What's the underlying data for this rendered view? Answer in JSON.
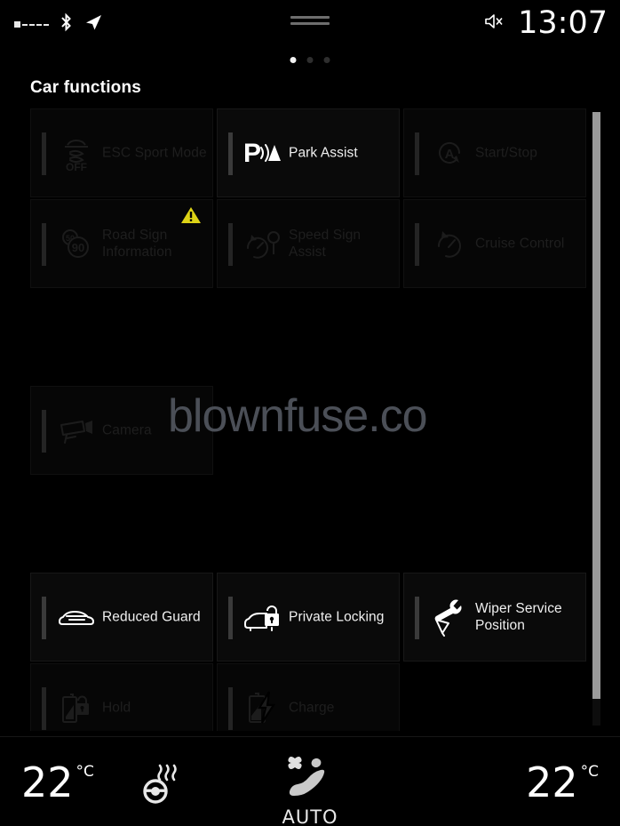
{
  "status_bar": {
    "signal_icon": "signal-strength-icon",
    "bluetooth_icon": "bluetooth-icon",
    "navigation_icon": "navigation-arrow-icon",
    "mute_icon": "volume-mute-icon",
    "clock": "13:07",
    "grab_handle_icon": "drag-handle-icon"
  },
  "page_dots": {
    "total": 3,
    "active_index": 0
  },
  "header": {
    "title": "Car functions"
  },
  "watermark": {
    "text": "blownfuse.co"
  },
  "scrollbar": {
    "name": "vertical-scrollbar"
  },
  "tiles": [
    {
      "id": "esc-sport-mode",
      "label": "ESC Sport Mode",
      "icon": "esc-off-icon",
      "state": "dim",
      "badge": null,
      "sublabel": "OFF"
    },
    {
      "id": "park-assist",
      "label": "Park Assist",
      "icon": "park-assist-icon",
      "state": "active",
      "badge": null
    },
    {
      "id": "start-stop",
      "label": "Start/Stop",
      "icon": "auto-start-stop-icon",
      "state": "dim",
      "badge": null
    },
    {
      "id": "road-sign-information",
      "label": "Road Sign Information",
      "icon": "road-sign-icon",
      "state": "dim",
      "badge": "warning-triangle-icon",
      "sign_values": [
        "50",
        "90"
      ]
    },
    {
      "id": "speed-sign-assist",
      "label": "Speed Sign Assist",
      "icon": "speed-sign-assist-icon",
      "state": "dim",
      "badge": null
    },
    {
      "id": "cruise-control",
      "label": "Cruise Control",
      "icon": "cruise-control-icon",
      "state": "dim",
      "badge": null
    },
    {
      "id": "camera",
      "label": "Camera",
      "icon": "camera-icon",
      "state": "dim",
      "badge": null
    },
    {
      "id": "reduced-guard",
      "label": "Reduced Guard",
      "icon": "reduced-guard-icon",
      "state": "active",
      "badge": null
    },
    {
      "id": "private-locking",
      "label": "Private Locking",
      "icon": "private-locking-icon",
      "state": "active",
      "badge": null
    },
    {
      "id": "wiper-service-position",
      "label": "Wiper Service Position",
      "icon": "wiper-service-icon",
      "state": "active",
      "badge": null
    },
    {
      "id": "hold",
      "label": "Hold",
      "icon": "battery-hold-icon",
      "state": "dim",
      "badge": null
    },
    {
      "id": "charge",
      "label": "Charge",
      "icon": "battery-charge-icon",
      "state": "dim",
      "badge": null
    }
  ],
  "climate_bar": {
    "left_temperature": "22",
    "left_unit": "°C",
    "right_temperature": "22",
    "right_unit": "°C",
    "steering_wheel_heat_icon": "heated-steering-wheel-icon",
    "auto_icon": "auto-airflow-icon",
    "auto_label": "AUTO"
  },
  "colors": {
    "background": "#000000",
    "tile_background": "#0a0a0a",
    "tile_border": "#181818",
    "accent_bar": "#3a3a3a",
    "text_active": "#f0f0f0",
    "text_dim": "#1e1e1e",
    "warning_yellow": "#ddd316",
    "scrollbar_thumb": "#9a9a9a",
    "watermark": "#4b4f57"
  }
}
